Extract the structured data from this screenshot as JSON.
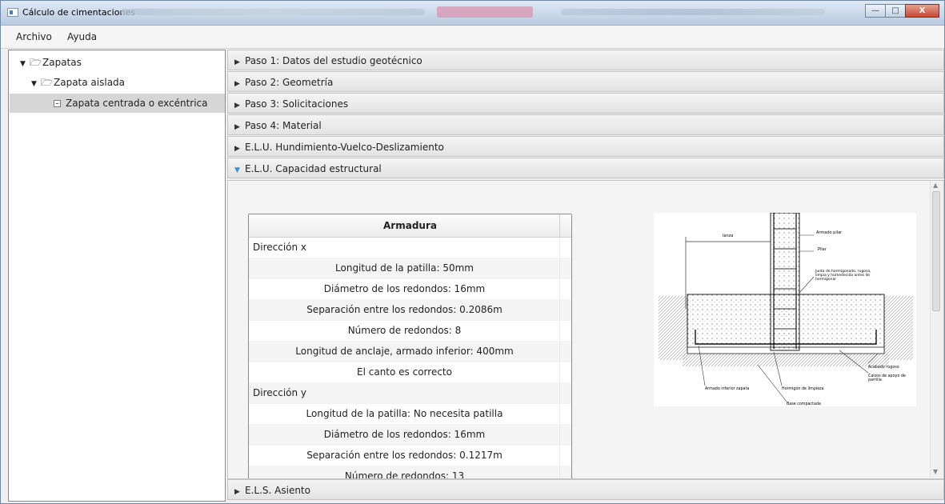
{
  "window": {
    "title": "Cálculo de cimentaciones",
    "buttons": {
      "minimize": "—",
      "maximize": "□",
      "close": "X"
    }
  },
  "menu": [
    "Archivo",
    "Ayuda"
  ],
  "tree": {
    "root": "Zapatas",
    "child": "Zapata aislada",
    "leaf": "Zapata centrada o excéntrica"
  },
  "panes": [
    {
      "label": "Paso 1: Datos del estudio geotécnico",
      "expanded": false
    },
    {
      "label": "Paso 2: Geometría",
      "expanded": false
    },
    {
      "label": "Paso 3: Solicitaciones",
      "expanded": false
    },
    {
      "label": "Paso 4: Material",
      "expanded": false
    },
    {
      "label": "E.L.U. Hundimiento-Vuelco-Deslizamiento",
      "expanded": false
    },
    {
      "label": "E.L.U. Capacidad estructural",
      "expanded": true
    },
    {
      "label": "E.L.S. Asiento",
      "expanded": false
    }
  ],
  "table": {
    "header": "Armadura",
    "rows": [
      {
        "text": "Dirección x",
        "type": "group"
      },
      {
        "text": "Longitud de la patilla: 50mm",
        "type": "item"
      },
      {
        "text": "Diámetro de los redondos: 16mm",
        "type": "item"
      },
      {
        "text": "Separación entre los redondos: 0.2086m",
        "type": "item"
      },
      {
        "text": "Número de redondos: 8",
        "type": "item"
      },
      {
        "text": "Longitud de anclaje, armado inferior: 400mm",
        "type": "item"
      },
      {
        "text": "El canto es correcto",
        "type": "item"
      },
      {
        "text": "Dirección y",
        "type": "group"
      },
      {
        "text": "Longitud de la patilla: No necesita patilla",
        "type": "item"
      },
      {
        "text": "Diámetro de los redondos: 16mm",
        "type": "item"
      },
      {
        "text": "Separación entre los redondos: 0.1217m",
        "type": "item"
      },
      {
        "text": "Número de redondos: 13",
        "type": "item"
      }
    ]
  },
  "drawing": {
    "labels": {
      "lb": "lanza",
      "armado_pilar": "Armado pilar",
      "pilar": "Pilar",
      "junta1": "Junta de hormigonado, rugosa,",
      "junta2": "limpia y humedecida antes de",
      "junta3": "hormigonar",
      "acabado": "Acabado rugoso",
      "calzos1": "Calzos de apoyo de",
      "calzos2": "parrilla",
      "armado_inferior": "Armado inferior zapata",
      "hormigon_limpieza": "Hormigón de limpieza",
      "base": "Base compactada"
    }
  }
}
